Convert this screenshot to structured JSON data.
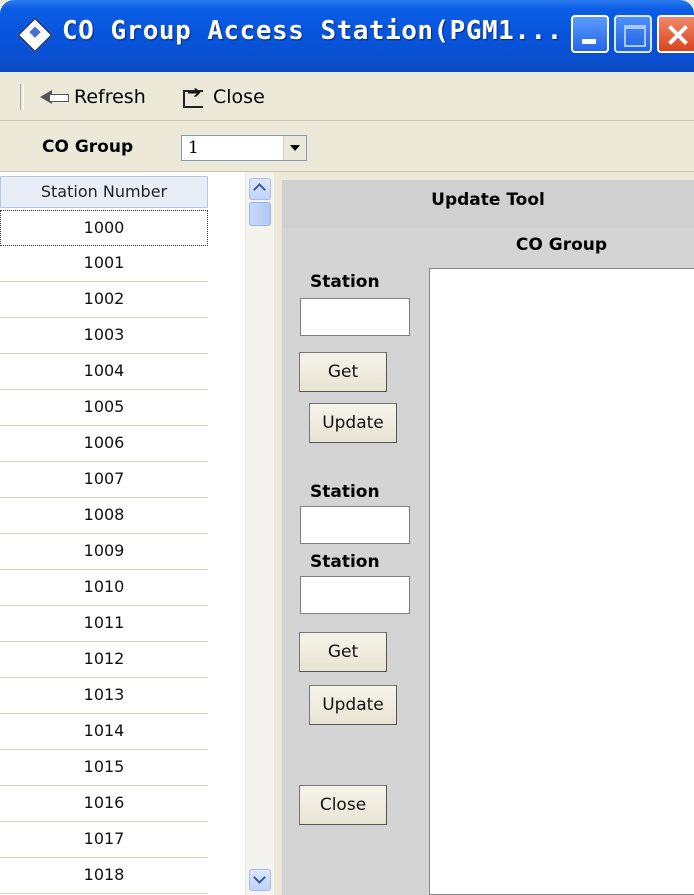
{
  "window": {
    "title": "CO Group Access Station(PGM1..."
  },
  "toolbar": {
    "refresh_label": "Refresh",
    "close_label": "Close"
  },
  "co_group": {
    "label": "CO Group",
    "selected": "1"
  },
  "station_list": {
    "header": "Station Number",
    "rows": [
      "1000",
      "1001",
      "1002",
      "1003",
      "1004",
      "1005",
      "1006",
      "1007",
      "1008",
      "1009",
      "1010",
      "1011",
      "1012",
      "1013",
      "1014",
      "1015",
      "1016",
      "1017",
      "1018"
    ]
  },
  "update_tool": {
    "title": "Update Tool",
    "co_group_header": "CO Group",
    "station1_label": "Station",
    "get1": "Get",
    "update1": "Update",
    "station2_label": "Station",
    "station3_label": "Station",
    "get2": "Get",
    "update2": "Update",
    "close": "Close"
  }
}
